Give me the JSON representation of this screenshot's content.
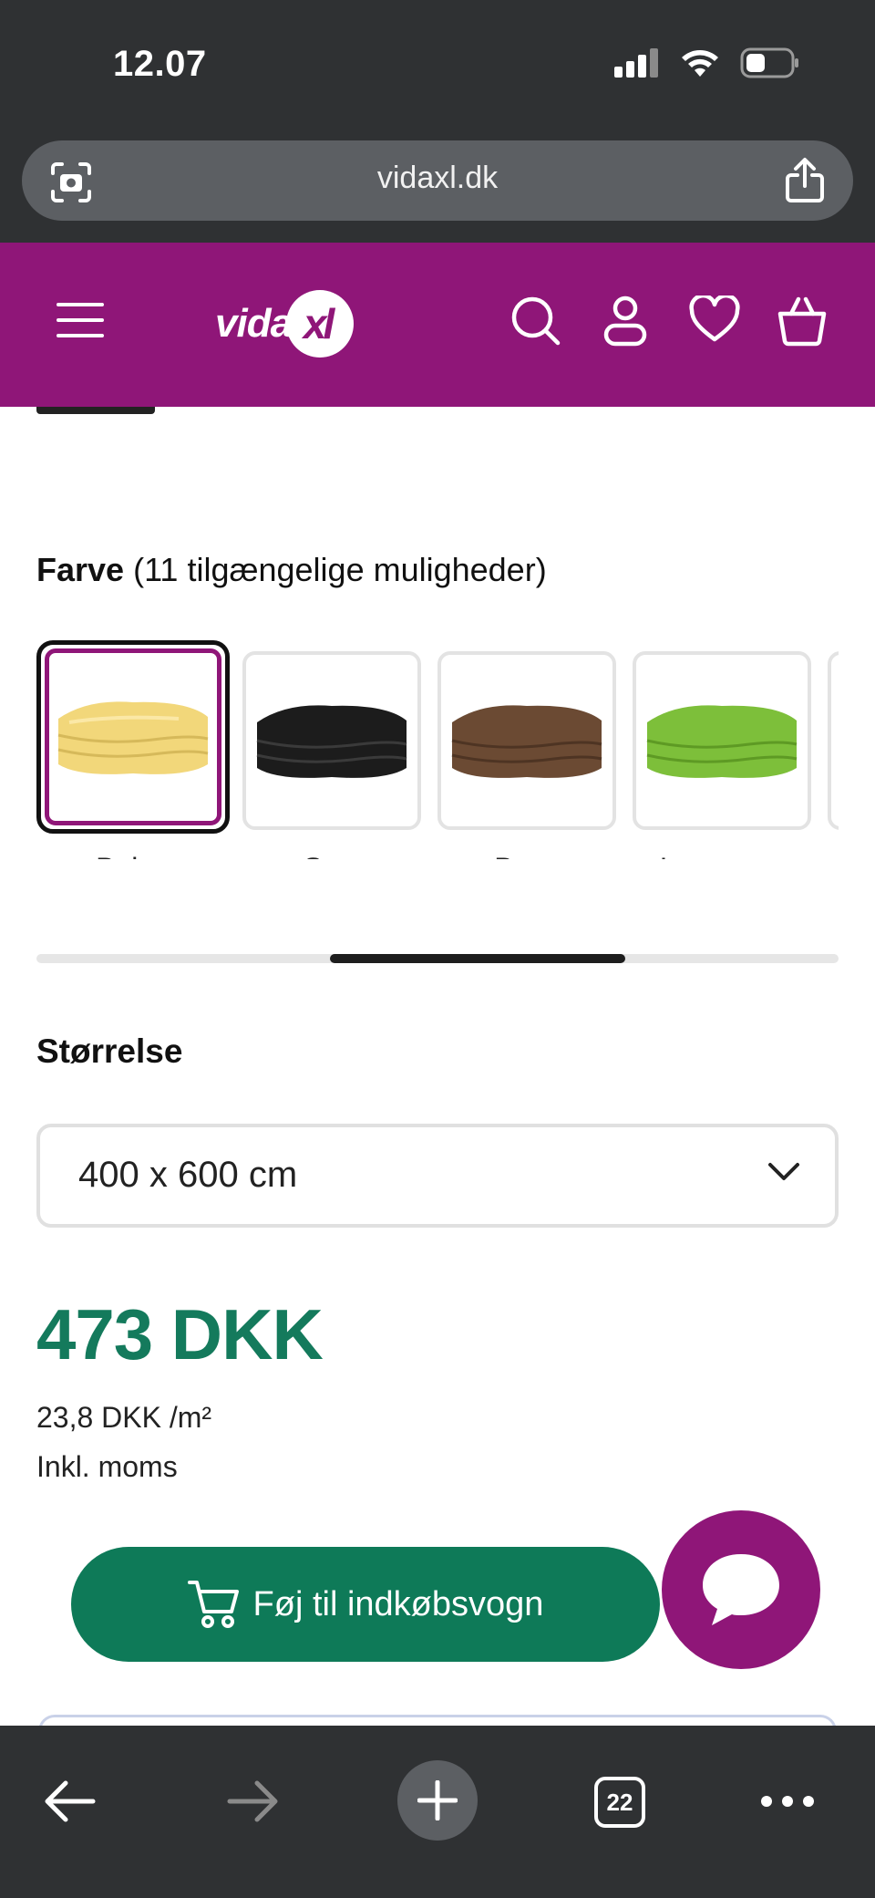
{
  "status_bar": {
    "time": "12.07"
  },
  "browser": {
    "url": "vidaxl.dk",
    "tab_count": "22"
  },
  "header": {
    "logo_text": "vida",
    "logo_mark": "xl"
  },
  "color_picker": {
    "label": "Farve",
    "count_text": "(11 tilgængelige muligheder)",
    "options": [
      {
        "name": "Beige",
        "color": "#f2d77a",
        "shade": "#d6b95a",
        "selected": true
      },
      {
        "name": "Sort",
        "color": "#1c1c1c",
        "shade": "#0a0a0a",
        "selected": false
      },
      {
        "name": "Brun",
        "color": "#6b4a33",
        "shade": "#4e3423",
        "selected": false
      },
      {
        "name": "Lysegrøn",
        "color": "#7dbf3a",
        "shade": "#5e9a24",
        "selected": false
      }
    ]
  },
  "size": {
    "label": "Størrelse",
    "selected": "400 x 600 cm"
  },
  "price": {
    "main": "473 DKK",
    "unit": "23,8 DKK /m²",
    "vat": "Inkl. moms"
  },
  "cart": {
    "label": "Føj til indkøbsvogn"
  },
  "colors": {
    "brand": "#8f1678",
    "price": "#147a5c",
    "cart_button": "#0e7a58"
  },
  "icons": {
    "status": [
      "signal-icon",
      "wifi-icon",
      "battery-icon"
    ],
    "header": [
      "menu-icon",
      "search-icon",
      "account-icon",
      "heart-icon",
      "basket-icon"
    ],
    "toolbar": [
      "back-icon",
      "forward-icon",
      "new-tab-icon",
      "tabs-icon",
      "more-icon"
    ]
  }
}
